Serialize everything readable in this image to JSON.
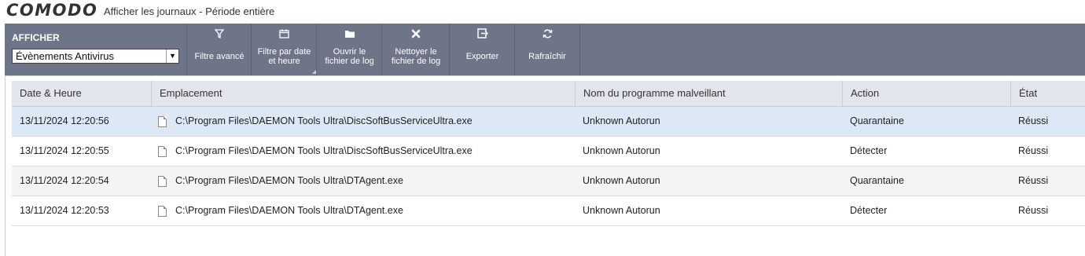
{
  "app": {
    "brand": "COMODO",
    "title": "Afficher les journaux - Période entière"
  },
  "toolbar": {
    "afficher_label": "AFFICHER",
    "view_select": {
      "value": "Évènements Antivirus"
    },
    "buttons": [
      {
        "icon": "filter-icon",
        "glyph": "⊤",
        "label": "Filtre avancé"
      },
      {
        "icon": "calendar-icon",
        "glyph": "▭",
        "label": "Filtre par date\net heure"
      },
      {
        "icon": "folder-icon",
        "glyph": "■",
        "label": "Ouvrir le\nfichier de log"
      },
      {
        "icon": "close-x-icon",
        "glyph": "✖",
        "label": "Nettoyer le\nfichier de log"
      },
      {
        "icon": "export-icon",
        "glyph": "⇥",
        "label": "Exporter"
      },
      {
        "icon": "refresh-icon",
        "glyph": "⟳",
        "label": "Rafraîchir"
      }
    ]
  },
  "table": {
    "columns": [
      "Date & Heure",
      "Emplacement",
      "Nom du programme malveillant",
      "Action",
      "État"
    ],
    "rows": [
      {
        "date": "13/11/2024 12:20:56",
        "location": "C:\\Program Files\\DAEMON Tools Ultra\\DiscSoftBusServiceUltra.exe",
        "malware": "Unknown Autorun",
        "action": "Quarantaine",
        "state": "Réussi"
      },
      {
        "date": "13/11/2024 12:20:55",
        "location": "C:\\Program Files\\DAEMON Tools Ultra\\DiscSoftBusServiceUltra.exe",
        "malware": "Unknown Autorun",
        "action": "Détecter",
        "state": "Réussi"
      },
      {
        "date": "13/11/2024 12:20:54",
        "location": "C:\\Program Files\\DAEMON Tools Ultra\\DTAgent.exe",
        "malware": "Unknown Autorun",
        "action": "Quarantaine",
        "state": "Réussi"
      },
      {
        "date": "13/11/2024 12:20:53",
        "location": "C:\\Program Files\\DAEMON Tools Ultra\\DTAgent.exe",
        "malware": "Unknown Autorun",
        "action": "Détecter",
        "state": "Réussi"
      }
    ]
  }
}
